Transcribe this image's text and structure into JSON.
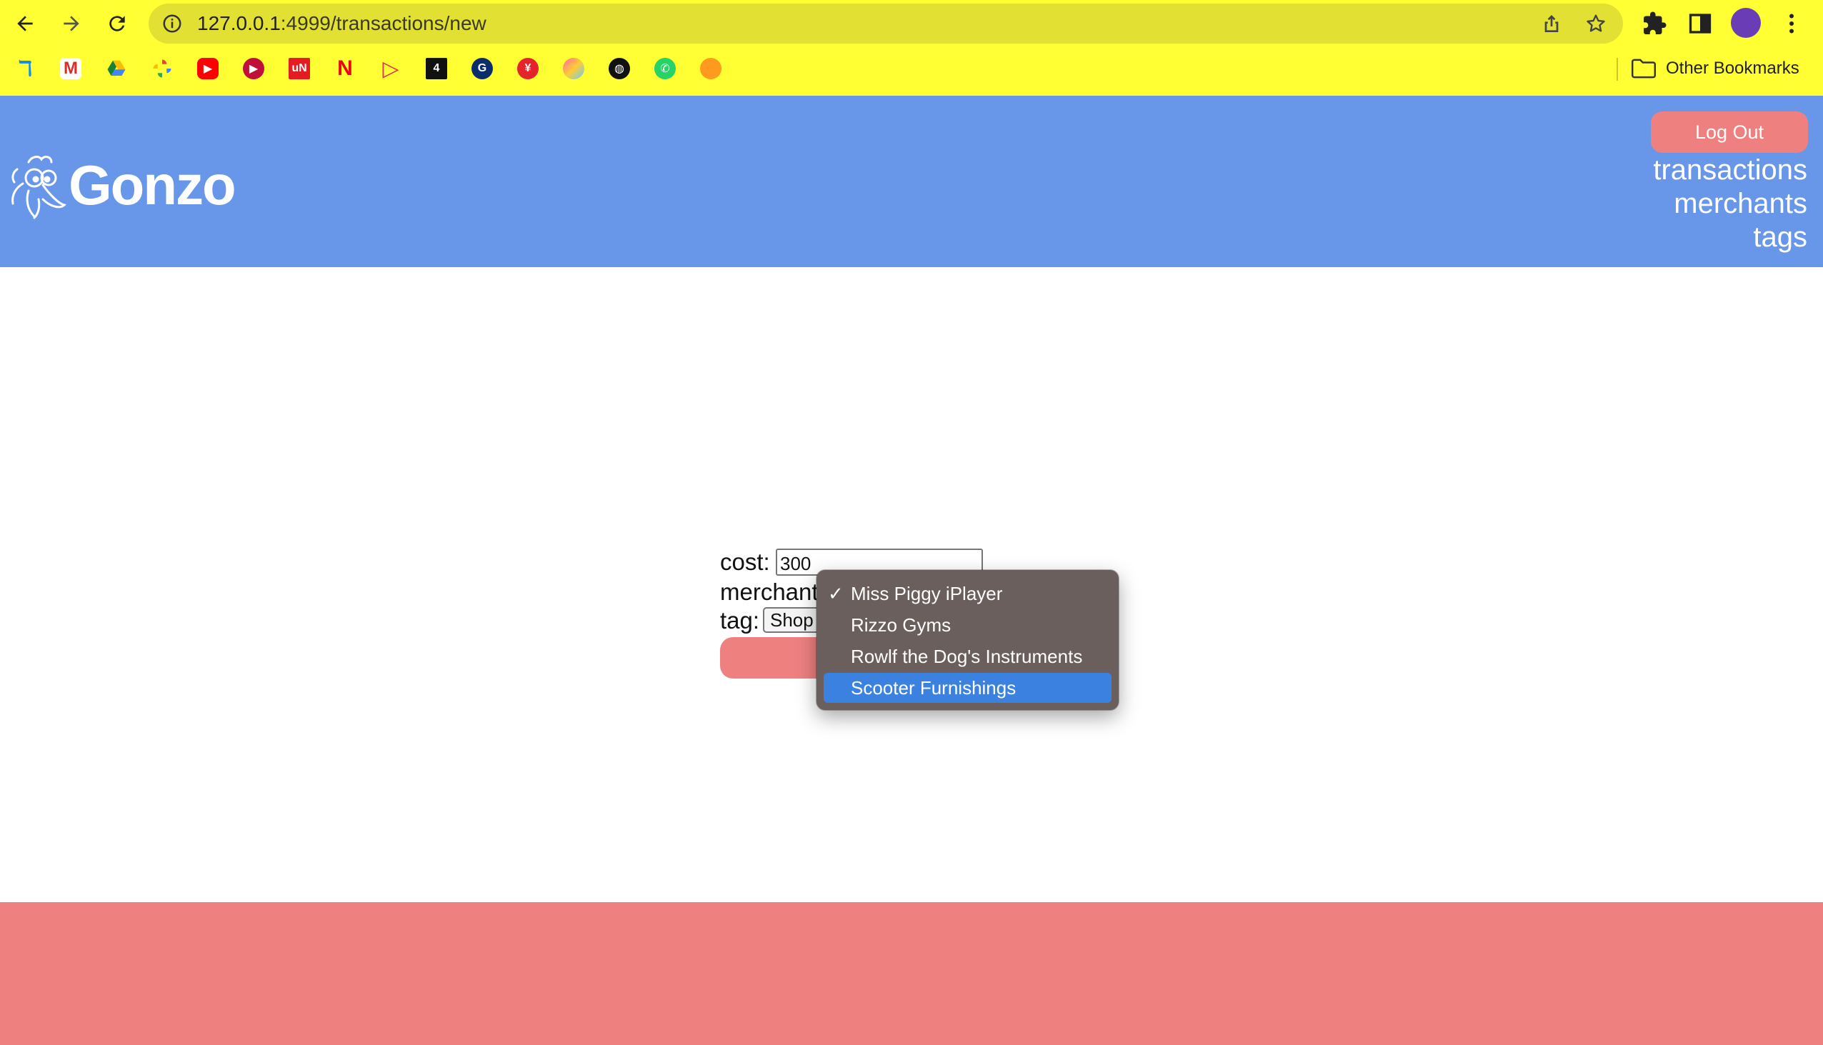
{
  "browser": {
    "url_host": "127.0.0.1",
    "url_path": ":4999/transactions/new",
    "other_bookmarks": "Other Bookmarks",
    "bookmarks": [
      "pocket-icon",
      "gmail-icon",
      "drive-icon",
      "photos-icon",
      "youtube-icon",
      "play-icon",
      "unidays-icon",
      "netflix-icon",
      "play-movies-icon",
      "channel4-icon",
      "guardian-icon",
      "bookmark-red-icon",
      "colorful-icon",
      "globe-icon",
      "whatsapp-icon",
      "orange-icon"
    ]
  },
  "header": {
    "logo_text": "Gonzo",
    "logout_label": "Log Out",
    "nav": {
      "transactions": "transactions",
      "merchants": "merchants",
      "tags": "tags"
    }
  },
  "form": {
    "cost_label": "cost:",
    "cost_value": "300",
    "merchant_label": "merchant",
    "tag_label": "tag:",
    "tag_value": "Shop"
  },
  "dropdown": {
    "options": [
      "Miss Piggy iPlayer",
      "Rizzo Gyms",
      "Rowlf the Dog's Instruments",
      "Scooter Furnishings"
    ],
    "checked": "Miss Piggy iPlayer",
    "highlighted": "Scooter Furnishings"
  },
  "colors": {
    "chrome": "#ffff33",
    "header": "#6897e9",
    "accent": "#ee8080",
    "highlight": "#3b82e0"
  }
}
